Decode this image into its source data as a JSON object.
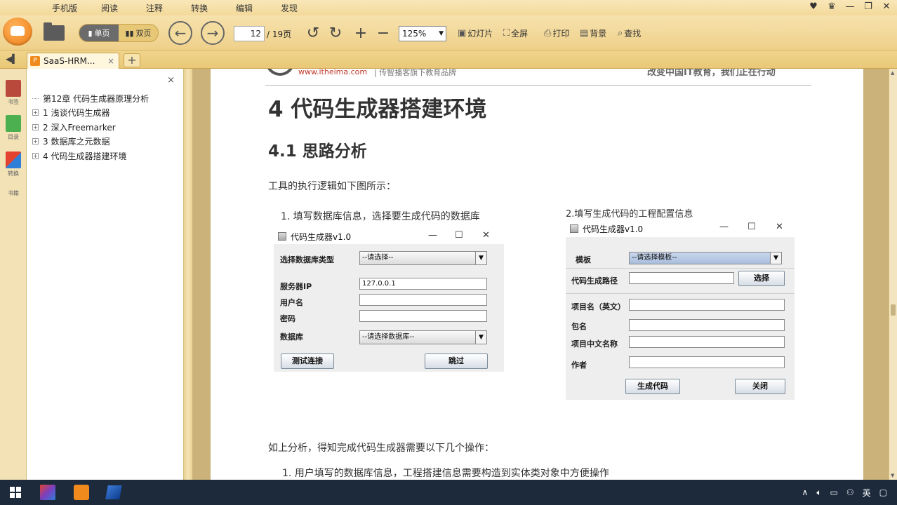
{
  "menu": [
    "手机版",
    "阅读",
    "注释",
    "转换",
    "编辑",
    "发现"
  ],
  "window_controls": [
    "♥",
    "♛",
    "—",
    "❐",
    "✕"
  ],
  "toolbar": {
    "view_single": "单页",
    "view_double": "双页",
    "page_current": "12",
    "page_total": "/ 19页",
    "zoom": "125%",
    "slideshow": "幻灯片",
    "fullscreen": "全屏",
    "print": "打印",
    "background": "背景",
    "find": "查找"
  },
  "tab": {
    "title": "SaaS-HRM...",
    "close": "×",
    "new": "+"
  },
  "iconbar": {
    "bookmark": "书签",
    "outline": "目录",
    "convert": "转换",
    "more": "书籍"
  },
  "outline": {
    "close": "×",
    "items": [
      {
        "label": "第12章 代码生成器原理分析",
        "expandable": false
      },
      {
        "label": "1 浅谈代码生成器",
        "expandable": true
      },
      {
        "label": "2 深入Freemarker",
        "expandable": true
      },
      {
        "label": "3 数据库之元数据",
        "expandable": true
      },
      {
        "label": "4 代码生成器搭建环境",
        "expandable": true
      }
    ]
  },
  "doc": {
    "header_url": "www.itheima.com",
    "header_sub": "| 传智播客旗下教育品牌",
    "header_right": "改变中国IT教育，我们正在行动",
    "h1": "4 代码生成器搭建环境",
    "h2": "4.1 思路分析",
    "intro": "工具的执行逻辑如下图所示：",
    "step1_caption": "1. 填写数据库信息，选择要生成代码的数据库",
    "step2_caption": "2.填写生成代码的工程配置信息",
    "analysis": "如上分析，得知完成代码生成器需要以下几个操作：",
    "list1": "1. 用户填写的数据库信息，工程搭建信息需要构造到实体类对象中方便操作"
  },
  "dialog1": {
    "title": "代码生成器v1.0",
    "controls": [
      "—",
      "☐",
      "✕"
    ],
    "db_type_label": "选择数据库类型",
    "db_type_value": "--请选择--",
    "server_ip_label": "服务器IP",
    "server_ip_value": "127.0.0.1",
    "username_label": "用户名",
    "username_value": "",
    "password_label": "密码",
    "password_value": "",
    "database_label": "数据库",
    "database_value": "--请选择数据库--",
    "test_btn": "测试连接",
    "next_btn": "跳过"
  },
  "dialog2": {
    "title": "代码生成器v1.0",
    "controls": [
      "—",
      "☐",
      "✕"
    ],
    "template_label": "模板",
    "template_value": "--请选择模板--",
    "path_label": "代码生成路径",
    "path_value": "",
    "choose_btn": "选择",
    "project_en_label": "项目名（英文）",
    "package_label": "包名",
    "project_cn_label": "项目中文名称",
    "author_label": "作者",
    "generate_btn": "生成代码",
    "close_btn": "关闭"
  },
  "tray": {
    "ime": "英"
  }
}
